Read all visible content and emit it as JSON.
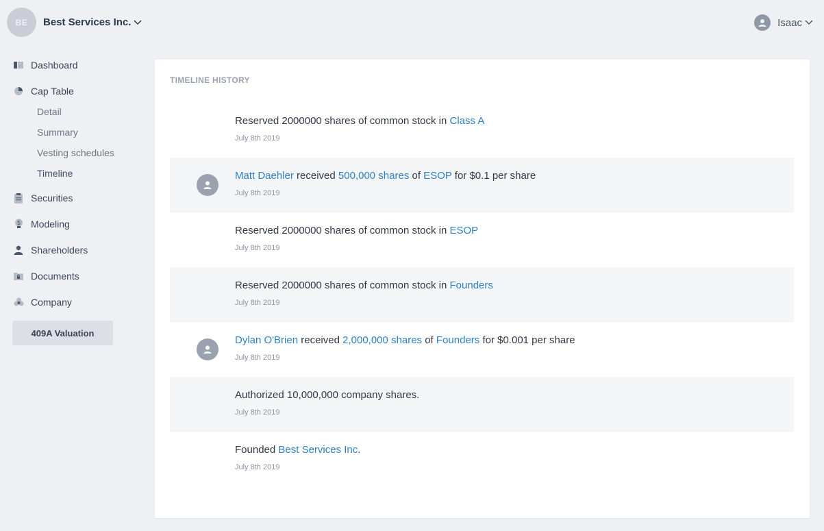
{
  "header": {
    "org_initials": "BE",
    "org_name": "Best Services Inc.",
    "user_name": "Isaac"
  },
  "sidebar": {
    "items": [
      {
        "label": "Dashboard",
        "icon": "dashboard-icon"
      },
      {
        "label": "Cap Table",
        "icon": "pie-chart-icon"
      },
      {
        "label": "Securities",
        "icon": "clipboard-icon"
      },
      {
        "label": "Modeling",
        "icon": "lightbulb-dollar-icon"
      },
      {
        "label": "Shareholders",
        "icon": "person-icon"
      },
      {
        "label": "Documents",
        "icon": "folder-lock-icon"
      },
      {
        "label": "Company",
        "icon": "company-icon"
      }
    ],
    "cap_table_subitems": [
      "Detail",
      "Summary",
      "Vesting schedules",
      "Timeline"
    ],
    "active_subitem": "Timeline",
    "valuation_button": "409A Valuation"
  },
  "main": {
    "title": "TIMELINE HISTORY",
    "events": [
      {
        "date": "July 8th 2019",
        "has_avatar": false,
        "t1": "Reserved 2000000 shares of common stock in ",
        "l1": "Class A"
      },
      {
        "date": "July 8th 2019",
        "has_avatar": true,
        "l0": "Matt Daehler",
        "t1": " received ",
        "l1": "500,000 shares",
        "t2": " of ",
        "l2": "ESOP",
        "t3": " for $0.1 per share"
      },
      {
        "date": "July 8th 2019",
        "has_avatar": false,
        "t1": "Reserved 2000000 shares of common stock in ",
        "l1": "ESOP"
      },
      {
        "date": "July 8th 2019",
        "has_avatar": false,
        "t1": "Reserved 2000000 shares of common stock in ",
        "l1": "Founders"
      },
      {
        "date": "July 8th 2019",
        "has_avatar": true,
        "l0": "Dylan O'Brien",
        "t1": " received ",
        "l1": "2,000,000 shares",
        "t2": " of ",
        "l2": "Founders",
        "t3": " for $0.001 per share"
      },
      {
        "date": "July 8th 2019",
        "has_avatar": false,
        "t1": "Authorized 10,000,000 company shares."
      },
      {
        "date": "July 8th 2019",
        "has_avatar": false,
        "t1": "Founded ",
        "l1": "Best Services Inc",
        "t2": "."
      }
    ]
  },
  "colors": {
    "background": "#eef0f3",
    "card": "#ffffff",
    "alt_row": "#f4f5f7",
    "link": "#2d80c2",
    "text": "#2e3948",
    "muted": "#8c94a1"
  }
}
